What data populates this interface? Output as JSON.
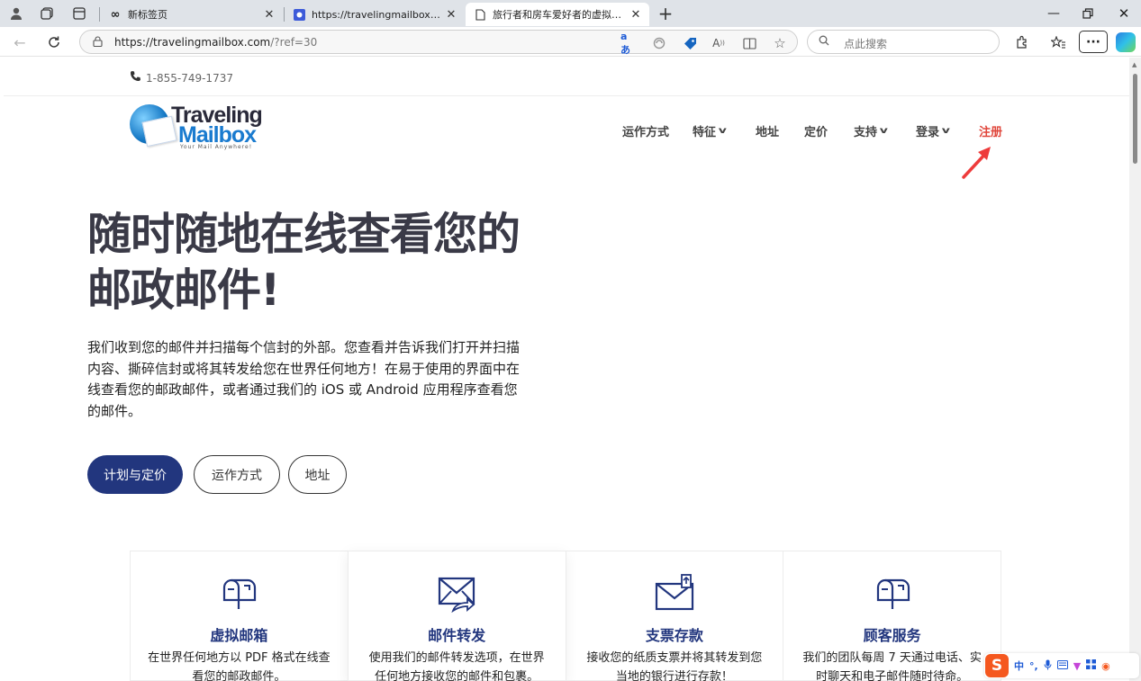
{
  "browser": {
    "tabs": [
      {
        "label": "新标签页",
        "active": false
      },
      {
        "label": "https://travelingmailbox.com/ref...",
        "active": false
      },
      {
        "label": "旅行者和房车爱好者的虚拟邮箱 |...",
        "active": true
      }
    ],
    "url_host": "https://travelingmailbox.com",
    "url_rest": "/?ref=30",
    "search_placeholder": "点此搜索"
  },
  "page": {
    "phone": "1-855-749-1737",
    "logo": {
      "line1": "Traveling",
      "line2": "Mailbox",
      "tagline": "Your Mail Anywhere!"
    },
    "nav": [
      {
        "label": "运作方式",
        "dropdown": false
      },
      {
        "label": "特征",
        "dropdown": true
      },
      {
        "label": "地址",
        "dropdown": false
      },
      {
        "label": "定价",
        "dropdown": false
      },
      {
        "label": "支持",
        "dropdown": true
      },
      {
        "label": "登录",
        "dropdown": true
      },
      {
        "label": "注册",
        "dropdown": false
      }
    ],
    "hero": {
      "title_line1": "随时随地在线查看您的",
      "title_line2": "邮政邮件!",
      "body": "我们收到您的邮件并扫描每个信封的外部。您查看并告诉我们打开并扫描内容、撕碎信封或将其转发给您在世界任何地方！在易于使用的界面中在线查看您的邮政邮件，或者通过我们的 iOS 或 Android 应用程序查看您的邮件。"
    },
    "buttons": {
      "primary": "计划与定价",
      "secondary1": "运作方式",
      "secondary2": "地址"
    },
    "features": [
      {
        "title": "虚拟邮箱",
        "text": "在世界任何地方以 PDF 格式在线查看您的邮政邮件。",
        "icon": "mailbox-icon"
      },
      {
        "title": "邮件转发",
        "text": "使用我们的邮件转发选项，在世界任何地方接收您的邮件和包裹。",
        "icon": "mail-forward-icon"
      },
      {
        "title": "支票存款",
        "text": "接收您的纸质支票并将其转发到您当地的银行进行存款！",
        "icon": "check-deposit-icon"
      },
      {
        "title": "顾客服务",
        "text": "我们的团队每周 7 天通过电话、实时聊天和电子邮件随时待命。",
        "icon": "customer-service-icon"
      }
    ]
  },
  "ime": {
    "label_zh": "中"
  },
  "colors": {
    "brand_navy": "#22367e",
    "signup_red": "#e0463b",
    "title_gray": "#3a3a47"
  }
}
